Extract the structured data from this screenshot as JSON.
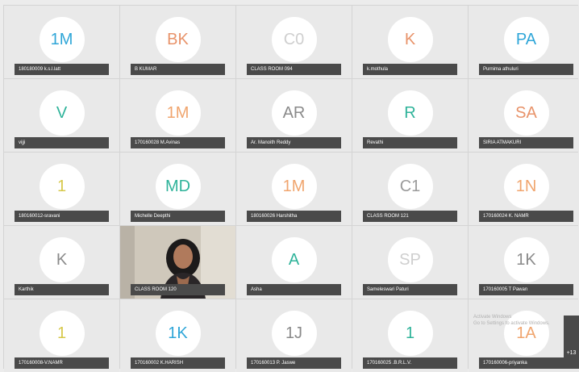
{
  "participants": [
    {
      "initials": "1M",
      "name": "180180009 k.s.l.latt",
      "color": "#2fa6d8"
    },
    {
      "initials": "BK",
      "name": "B KUMAR",
      "color": "#e8936a"
    },
    {
      "initials": "C0",
      "name": "CLASS ROOM 094",
      "color": "#cfcfcf"
    },
    {
      "initials": "K",
      "name": "k.mothula",
      "color": "#e8936a"
    },
    {
      "initials": "PA",
      "name": "Purnima athuluri",
      "color": "#2fa6d8"
    },
    {
      "initials": "V",
      "name": "vijji",
      "color": "#2fb39a"
    },
    {
      "initials": "1M",
      "name": "170160028 M.Avinas",
      "color": "#f0a56e"
    },
    {
      "initials": "AR",
      "name": "Ar. Manoith Reddy",
      "color": "#8a8a8a"
    },
    {
      "initials": "R",
      "name": "Revathi",
      "color": "#2fb39a"
    },
    {
      "initials": "SA",
      "name": "SIRIA ATMAKURI",
      "color": "#e8936a"
    },
    {
      "initials": "1",
      "name": "180160012-sravani",
      "color": "#d6c84a"
    },
    {
      "initials": "MD",
      "name": "Michelle Deepthi",
      "color": "#2fb39a"
    },
    {
      "initials": "1M",
      "name": "180160026 Harshitha",
      "color": "#f0a56e"
    },
    {
      "initials": "C1",
      "name": "CLASS ROOM 121",
      "color": "#9a9a9a"
    },
    {
      "initials": "1N",
      "name": "170160024 K. NAMR",
      "color": "#f0a56e"
    },
    {
      "initials": "K",
      "name": "Karthik",
      "color": "#8a8a8a"
    },
    {
      "initials": "",
      "name": "CLASS ROOM 120",
      "color": "#000000",
      "video": true
    },
    {
      "initials": "A",
      "name": "Asha",
      "color": "#2fb39a"
    },
    {
      "initials": "SP",
      "name": "Sameleswari Paturi",
      "color": "#cfcfcf"
    },
    {
      "initials": "1K",
      "name": "170160005 T Pawan",
      "color": "#8a8a8a"
    },
    {
      "initials": "1",
      "name": "170160008-V.NAMR",
      "color": "#d6c84a"
    },
    {
      "initials": "1K",
      "name": "170160002 K.HARISH",
      "color": "#2fa6d8"
    },
    {
      "initials": "1J",
      "name": "170160013 P. Jaswe",
      "color": "#8a8a8a"
    },
    {
      "initials": "1",
      "name": "170160025 .B.R.L.V.",
      "color": "#2fb39a"
    },
    {
      "initials": "1A",
      "name": "170160006-priyanka",
      "color": "#f0a56e"
    }
  ],
  "overflow_count": "+13",
  "watermark": {
    "line1": "Activate Windows",
    "line2": "Go to Settings to activate Windows."
  }
}
